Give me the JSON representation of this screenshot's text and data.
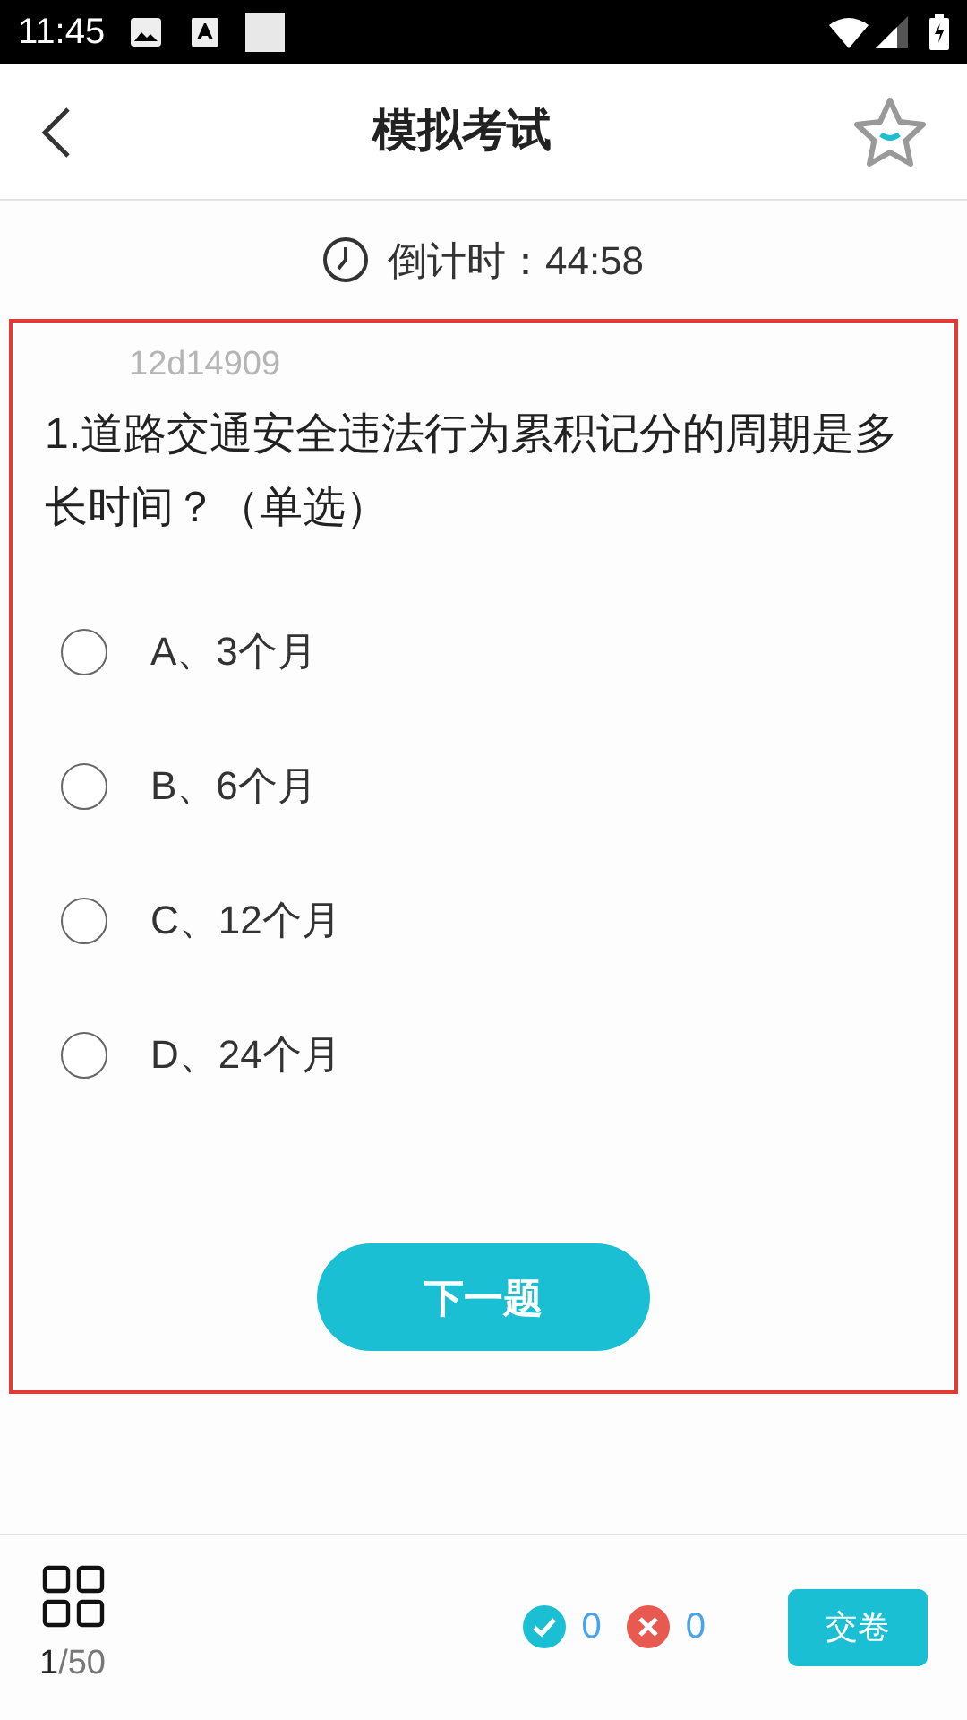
{
  "status_bar": {
    "time": "11:45"
  },
  "header": {
    "title": "模拟考试",
    "favorited": false
  },
  "timer": {
    "label": "倒计时：44:58"
  },
  "question": {
    "code": "12d14909",
    "text": "1.道路交通安全违法行为累积记分的周期是多长时间？（单选）",
    "options": [
      {
        "label": "A、3个月",
        "selected": false
      },
      {
        "label": "B、6个月",
        "selected": false
      },
      {
        "label": "C、12个月",
        "selected": false
      },
      {
        "label": "D、24个月",
        "selected": false
      }
    ],
    "next_button": "下一题"
  },
  "bottom_bar": {
    "current": "1",
    "total": "/50",
    "correct_count": "0",
    "wrong_count": "0",
    "submit_button": "交卷"
  }
}
